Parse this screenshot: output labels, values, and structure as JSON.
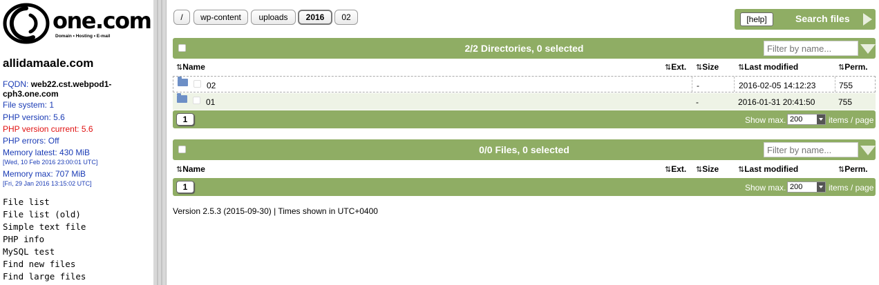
{
  "sidebar": {
    "logo_text": "one.com",
    "logo_tagline": "Domain • Hosting • E-mail",
    "site_name": "allidamaale.com",
    "fqdn_label": "FQDN:",
    "fqdn_value": "web22.cst.webpod1-cph3.one.com",
    "file_system": "File system: 1",
    "php_version": "PHP version: 5.6",
    "php_version_current": "PHP version current: 5.6",
    "php_errors": "PHP errors: Off",
    "memory_latest": "Memory latest: 430 MiB",
    "memory_latest_time": "[Wed, 10 Feb 2016 23:00:01 UTC]",
    "memory_max": "Memory max: 707 MiB",
    "memory_max_time": "[Fri, 29 Jan 2016 13:15:02 UTC]",
    "nav": [
      "File list",
      "File list (old)",
      "Simple text file",
      "PHP info",
      "MySQL test",
      "Find new files",
      "Find large files"
    ]
  },
  "breadcrumbs": [
    "/",
    "wp-content",
    "uploads",
    "2016",
    "02"
  ],
  "search": {
    "help_label": "[help]",
    "label": "Search files"
  },
  "directories": {
    "title": "2/2 Directories, 0 selected",
    "filter_placeholder": "Filter by name...",
    "columns": {
      "name": "Name",
      "ext": "Ext.",
      "size": "Size",
      "modified": "Last modified",
      "perm": "Perm."
    },
    "rows": [
      {
        "name": "02",
        "size": "-",
        "modified": "2016-02-05 14:12:23",
        "perm": "755"
      },
      {
        "name": "01",
        "size": "-",
        "modified": "2016-01-31 20:41:50",
        "perm": "755"
      }
    ],
    "page": "1",
    "show_max_label": "Show max.",
    "show_max_value": "200",
    "items_per_page": "items / page"
  },
  "files": {
    "title": "0/0 Files, 0 selected",
    "filter_placeholder": "Filter by name...",
    "columns": {
      "name": "Name",
      "ext": "Ext.",
      "size": "Size",
      "modified": "Last modified",
      "perm": "Perm."
    },
    "page": "1",
    "show_max_label": "Show max.",
    "show_max_value": "200",
    "items_per_page": "items / page"
  },
  "footer": {
    "version": "Version 2.5.3 (2015-09-30) | Times shown in UTC+0400"
  },
  "colors": {
    "bar_green": "#8fad64",
    "link_blue": "#1a3bb5",
    "warning_red": "#e01010"
  },
  "icons": {
    "sort": "⇅",
    "folder": "folder-icon"
  }
}
